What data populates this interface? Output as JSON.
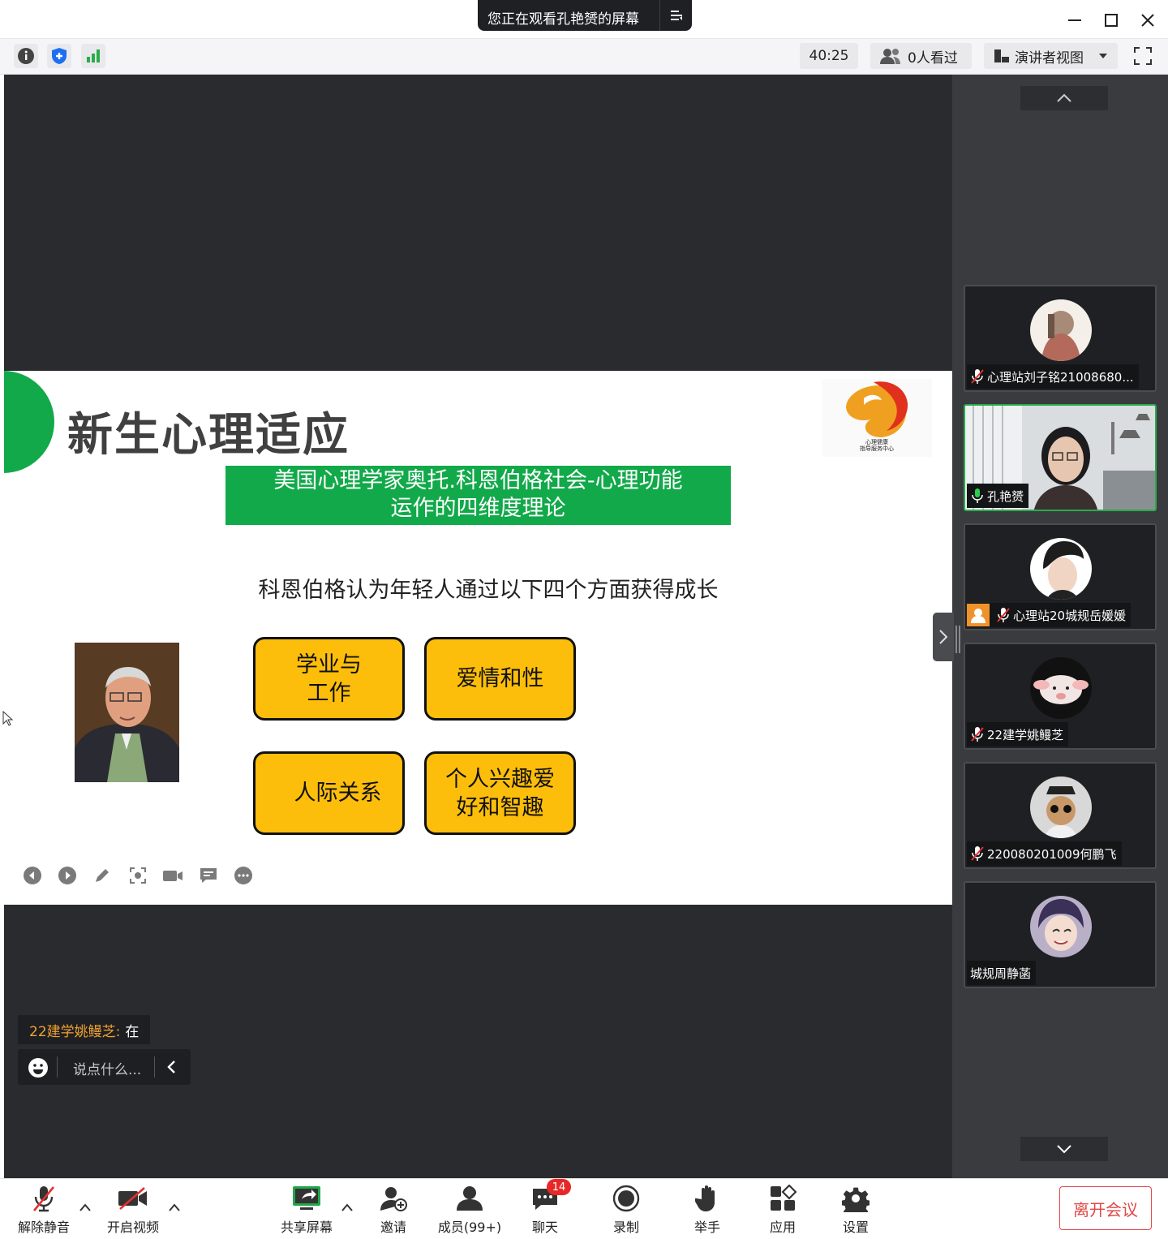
{
  "titlebar": {
    "banner_text": "您正在观看孔艳赟的屏幕"
  },
  "infobar": {
    "timer": "40:25",
    "viewers": "0人看过",
    "view_mode": "演讲者视图"
  },
  "slide": {
    "title": "新生心理适应",
    "banner_line1": "美国心理学家奥托.科恩伯格社会-心理功能",
    "banner_line2": "运作的四维度理论",
    "intro": "科恩伯格认为年轻人通过以下四个方面获得成长",
    "logo_caption": "心理健康\n指导服务中心",
    "boxes": [
      {
        "line1": "学业与",
        "line2": "工作"
      },
      {
        "line1": "爱情和性",
        "line2": ""
      },
      {
        "line1": "人际关系",
        "line2": ""
      },
      {
        "line1": "个人兴趣爱",
        "line2": "好和智趣"
      }
    ]
  },
  "participants": [
    {
      "name": "心理站刘子铭21008680...",
      "muted": true
    },
    {
      "name": "孔艳赟",
      "muted": false,
      "speaking": true
    },
    {
      "name": "心理站20城规岳媛媛",
      "muted": true,
      "host_badge": true
    },
    {
      "name": "22建学姚鳗芝",
      "muted": true
    },
    {
      "name": "220080201009何鹏飞",
      "muted": true
    },
    {
      "name": "城规周静菡",
      "muted": false
    }
  ],
  "chat": {
    "sender": "22建学姚鳗芝:",
    "message": "在",
    "placeholder": "说点什么..."
  },
  "toolbar": {
    "unmute": "解除静音",
    "start_video": "开启视频",
    "share_screen": "共享屏幕",
    "invite": "邀请",
    "members": "成员(99+)",
    "chat": "聊天",
    "chat_badge": "14",
    "record": "录制",
    "raise_hand": "举手",
    "apps": "应用",
    "settings": "设置",
    "leave": "离开会议"
  },
  "colors": {
    "accent_green": "#12a94a",
    "box_yellow": "#fdbe0b",
    "leave_red": "#e04848",
    "badge_red": "#e82727"
  }
}
